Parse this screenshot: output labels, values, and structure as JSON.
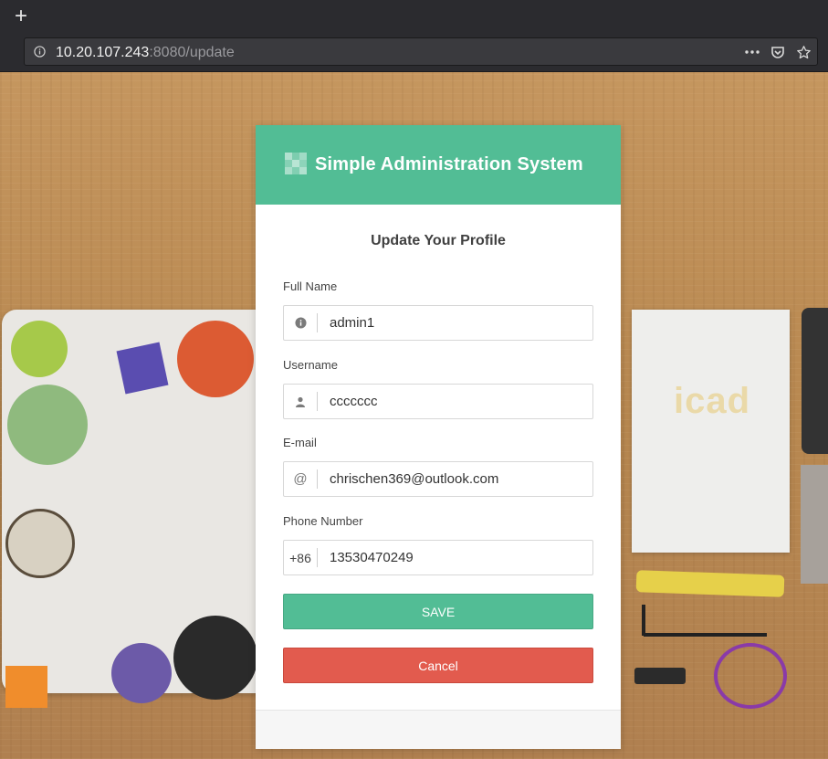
{
  "browser": {
    "new_tab_label": "+",
    "url_host": "10.20.107.243",
    "url_rest": ":8080/update",
    "actions": [
      "more-icon",
      "pocket-icon",
      "bookmark-star-icon"
    ]
  },
  "app": {
    "title": "Simple Administration System",
    "accent_color": "#52bd95",
    "danger_color": "#e25b4e"
  },
  "form": {
    "title": "Update Your Profile",
    "fields": [
      {
        "label": "Full Name",
        "icon": "info-icon",
        "addon_text": "",
        "value": "admin1"
      },
      {
        "label": "Username",
        "icon": "user-icon",
        "addon_text": "",
        "value": "ccccccc"
      },
      {
        "label": "E-mail",
        "icon": "at-icon",
        "addon_text": "@",
        "value": "chrischen369@outlook.com"
      },
      {
        "label": "Phone Number",
        "icon": "",
        "addon_text": "+86",
        "value": "13530470249"
      }
    ],
    "save_label": "SAVE",
    "cancel_label": "Cancel"
  },
  "background": {
    "doc_logo": "icad"
  }
}
